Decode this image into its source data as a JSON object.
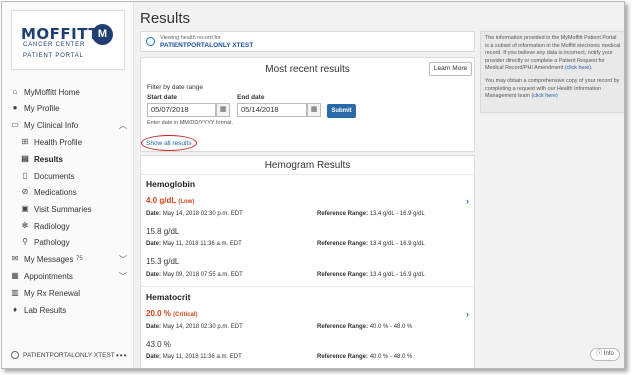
{
  "brand": {
    "name": "MOFFITT",
    "line1": "CANCER CENTER",
    "line2": "PATIENT PORTAL",
    "mark": "M",
    "color": "#1f3f73"
  },
  "nav": {
    "items": [
      {
        "label": "MyMoffitt Home",
        "icon": "home-icon"
      },
      {
        "label": "My Profile",
        "icon": "person-icon"
      },
      {
        "label": "My Clinical Info",
        "icon": "folder-icon"
      },
      {
        "label": "Health Profile",
        "icon": "plus-square-icon"
      },
      {
        "label": "Results",
        "icon": "chart-icon"
      },
      {
        "label": "Documents",
        "icon": "document-icon"
      },
      {
        "label": "Medications",
        "icon": "pill-icon"
      },
      {
        "label": "Visit Summaries",
        "icon": "clipboard-icon"
      },
      {
        "label": "Radiology",
        "icon": "radiology-icon"
      },
      {
        "label": "Pathology",
        "icon": "microscope-icon"
      },
      {
        "label": "My Messages",
        "icon": "mail-icon",
        "count": "75"
      },
      {
        "label": "Appointments",
        "icon": "calendar-icon"
      },
      {
        "label": "My Rx Renewal",
        "icon": "rx-icon"
      },
      {
        "label": "Lab Results",
        "icon": "drop-icon"
      }
    ],
    "user": "PATIENTPORTALONLY XTEST"
  },
  "page": {
    "title": "Results"
  },
  "record": {
    "label": "Viewing health record for",
    "name": "PATIENTPORTALONLY XTEST"
  },
  "recent": {
    "heading": "Most recent results",
    "learn_more": "Learn More",
    "filter_label": "Filter by date range",
    "start_label": "Start date",
    "start_value": "05/07/2018",
    "end_label": "End date",
    "end_value": "05/14/2018",
    "submit": "Submit",
    "hint": "Enter date in MM/DD/YYYY format.",
    "show_all": "Show all results"
  },
  "hemogram": {
    "heading": "Hemogram Results",
    "date_label": "Date:",
    "range_label": "Reference Range:",
    "tests": [
      {
        "name": "Hemoglobin",
        "results": [
          {
            "value": "4.0 g/dL",
            "flag": "(Low)",
            "date": "May 14, 2018 02:30 p.m. EDT",
            "range": "13.4 g/dL - 16.9 g/dL"
          },
          {
            "value": "15.8 g/dL",
            "flag": "",
            "date": "May 11, 2018 11:36 a.m. EDT",
            "range": "13.4 g/dL - 16.9 g/dL"
          },
          {
            "value": "15.3 g/dL",
            "flag": "",
            "date": "May 09, 2018 07:55 a.m. EDT",
            "range": "13.4 g/dL - 16.9 g/dL"
          }
        ]
      },
      {
        "name": "Hematocrit",
        "results": [
          {
            "value": "20.0 %",
            "flag": "(Critical)",
            "date": "May 14, 2018 02:30 p.m. EDT",
            "range": "40.0 % - 48.0 %"
          },
          {
            "value": "43.0 %",
            "flag": "",
            "date": "May 11, 2018 11:36 a.m. EDT",
            "range": "40.0 % - 48.0 %"
          }
        ]
      }
    ]
  },
  "info": {
    "p1": "The information provided in the MyMoffitt Patient Portal is a subset of information in the Moffitt electronic medical record. If you believe any data is incorrect, notify your provider directly or complete a Patient Request for Medical Record/PHI Amendment",
    "p1_link": "(click here).",
    "p2": "You may obtain a comprehensive copy of your record by completing a request with our Health Information Management team",
    "p2_link": "(click here)",
    "button": "Info"
  },
  "colors": {
    "accent": "#2a6aa8",
    "alert": "#d4441a",
    "annotation": "#d12020"
  }
}
